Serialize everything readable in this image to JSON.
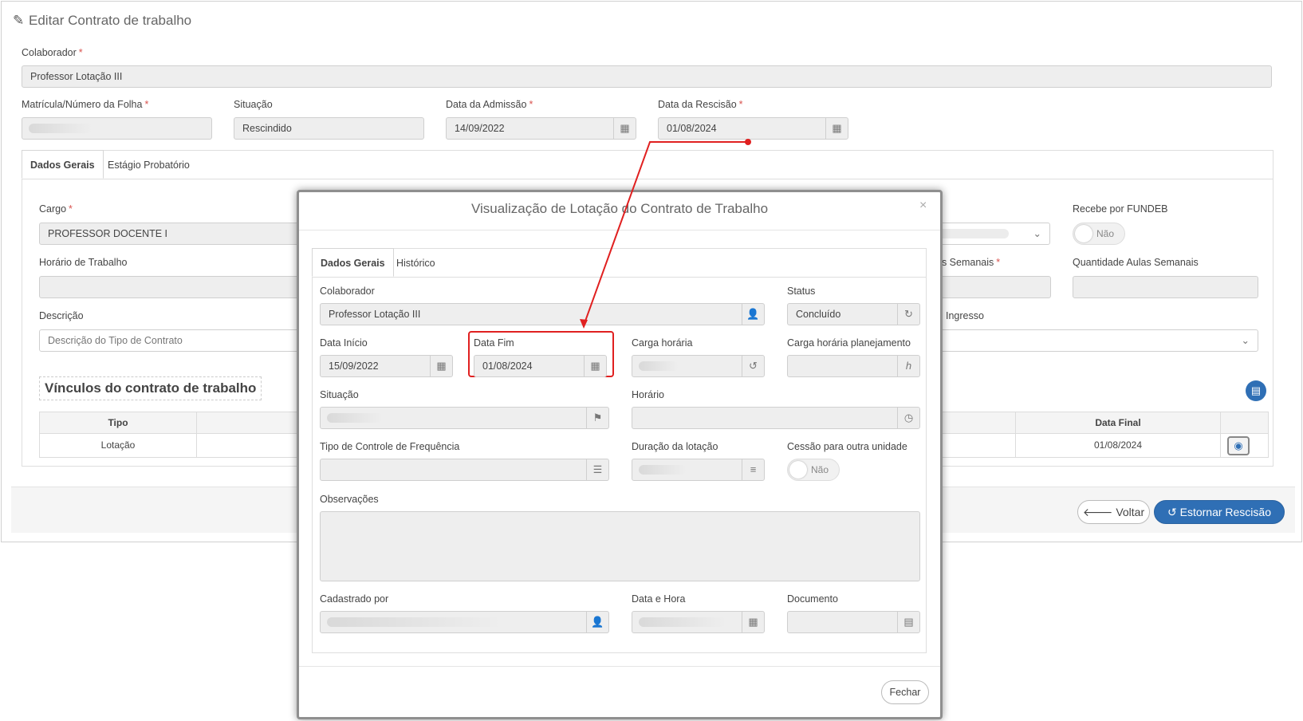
{
  "page": {
    "title": "Editar Contrato de trabalho",
    "colaborador_label": "Colaborador",
    "colaborador_value": "Professor Lotação III",
    "matricula_label": "Matrícula/Número da Folha",
    "situacao_label": "Situação",
    "situacao_value": "Rescindido",
    "admissao_label": "Data da Admissão",
    "admissao_value": "14/09/2022",
    "rescisao_label": "Data da Rescisão",
    "rescisao_value": "01/08/2024",
    "required_mark": "*"
  },
  "tabs": {
    "dados_gerais": "Dados Gerais",
    "estagio": "Estágio Probatório"
  },
  "general": {
    "cargo_label": "Cargo",
    "cargo_value": "PROFESSOR DOCENTE I",
    "recebe_fundeb_label": "Recebe por FUNDEB",
    "recebe_fundeb_value": "Não",
    "horario_label": "Horário de Trabalho",
    "aulas_semanais_partial": "as Semanais",
    "qtd_aulas_label": "Quantidade Aulas Semanais",
    "descricao_label": "Descrição",
    "descricao_placeholder": "Descrição do Tipo de Contrato",
    "ingresso_partial": "Ingresso"
  },
  "vinculos": {
    "title": "Vínculos do contrato de trabalho",
    "col_tipo": "Tipo",
    "col_data_final": "Data Final",
    "row_tipo": "Lotação",
    "row_data_final": "01/08/2024"
  },
  "buttons": {
    "voltar": "Voltar",
    "estornar": "Estornar Rescisão"
  },
  "modal": {
    "title": "Visualização de Lotação do Contrato de Trabalho",
    "close": "×",
    "tab_dados_gerais": "Dados Gerais",
    "tab_historico": "Histórico",
    "colaborador_label": "Colaborador",
    "colaborador_value": "Professor Lotação III",
    "status_label": "Status",
    "status_value": "Concluído",
    "data_inicio_label": "Data Início",
    "data_inicio_value": "15/09/2022",
    "data_fim_label": "Data Fim",
    "data_fim_value": "01/08/2024",
    "carga_horaria_label": "Carga horária",
    "carga_plan_label": "Carga horária planejamento",
    "carga_plan_addon": "h",
    "situacao_label": "Situação",
    "horario_label": "Horário",
    "tipo_controle_label": "Tipo de Controle de Frequência",
    "duracao_label": "Duração da lotação",
    "cessao_label": "Cessão para outra unidade",
    "cessao_value": "Não",
    "observacoes_label": "Observações",
    "cadastrado_label": "Cadastrado por",
    "data_hora_label": "Data e Hora",
    "documento_label": "Documento",
    "fechar": "Fechar"
  },
  "colors": {
    "accent": "#2f6fb5",
    "annotation": "#e02020"
  }
}
